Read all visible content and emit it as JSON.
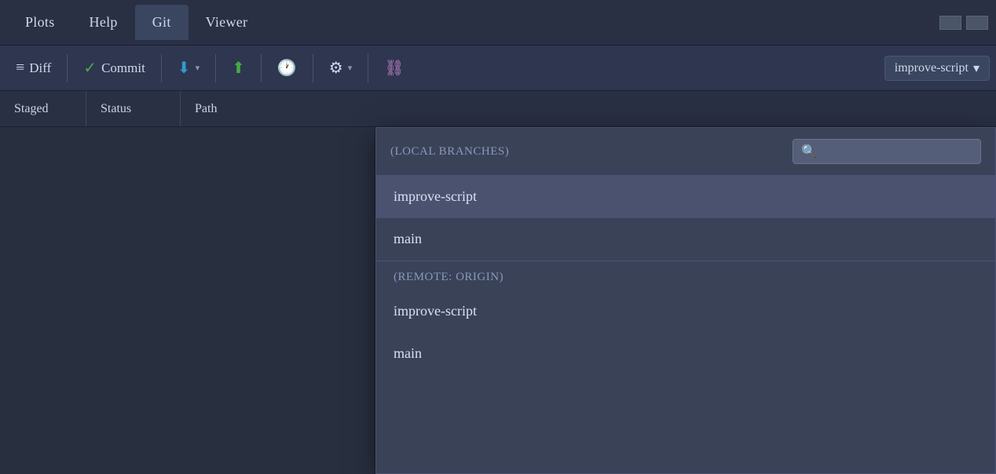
{
  "menu": {
    "tabs": [
      {
        "label": "Plots",
        "active": false
      },
      {
        "label": "Help",
        "active": false
      },
      {
        "label": "Git",
        "active": true
      },
      {
        "label": "Viewer",
        "active": false
      }
    ]
  },
  "toolbar": {
    "diff_label": "Diff",
    "commit_label": "Commit",
    "branch_current": "improve-script",
    "branch_dropdown_arrow": "▼"
  },
  "columns": {
    "staged": "Staged",
    "status": "Status",
    "path": "Path"
  },
  "dropdown": {
    "local_section": "(LOCAL BRANCHES)",
    "remote_section": "(REMOTE: ORIGIN)",
    "search_placeholder": "",
    "local_branches": [
      {
        "name": "improve-script",
        "selected": true
      },
      {
        "name": "main",
        "selected": false
      }
    ],
    "remote_branches": [
      {
        "name": "improve-script",
        "selected": false
      },
      {
        "name": "main",
        "selected": false
      }
    ]
  },
  "icons": {
    "diff": "≡",
    "commit_check": "✓",
    "pull_down": "⬇",
    "push_up": "⬆",
    "clock": "🕐",
    "gear": "⚙",
    "graph": "⛓",
    "search": "🔍",
    "minimize": "─",
    "maximize": "□",
    "dropdown_arrow": "▾"
  }
}
